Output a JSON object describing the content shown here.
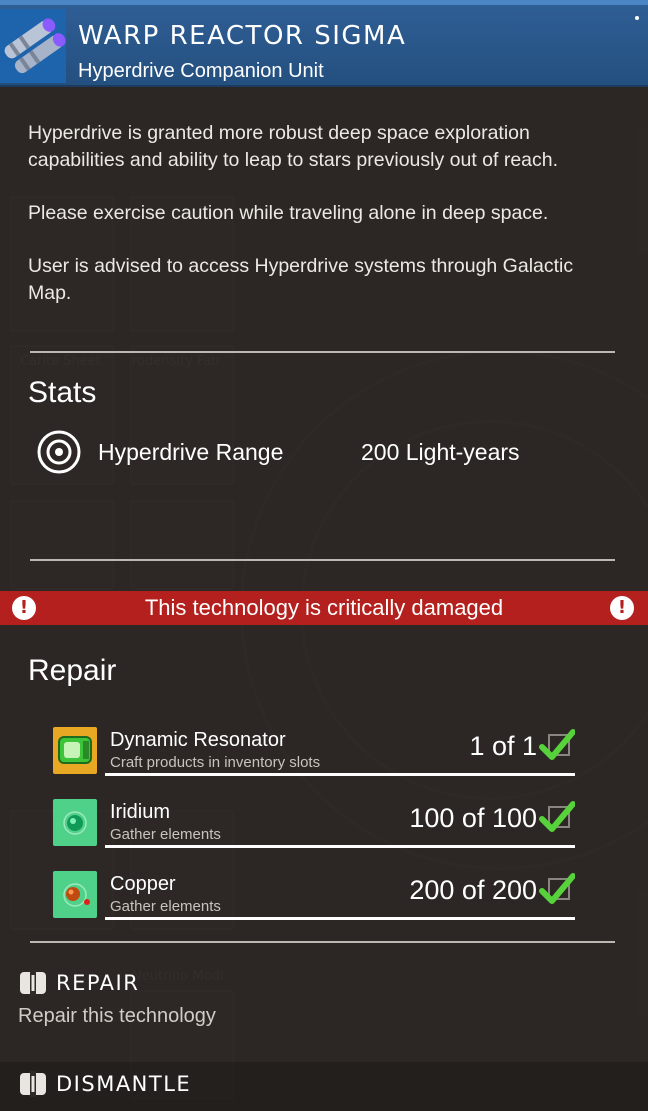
{
  "header": {
    "title": "WARP REACTOR SIGMA",
    "subtitle": "Hyperdrive Companion Unit",
    "icon": "warp-reactor-icon",
    "color": "#2f5e95"
  },
  "description": [
    "Hyperdrive is granted more robust deep space exploration capabilities and ability to leap to stars previously out of reach.",
    "Please exercise caution while traveling alone in deep space.",
    "User is advised to access Hyperdrive systems through Galactic Map."
  ],
  "stats": {
    "title": "Stats",
    "items": [
      {
        "icon": "target-icon",
        "name": "Hyperdrive Range",
        "value": "200 Light-years"
      }
    ]
  },
  "warning": {
    "text": "This technology is critically damaged",
    "color": "#b3201d"
  },
  "repair": {
    "title": "Repair",
    "requirements": [
      {
        "name": "Dynamic Resonator",
        "subtitle": "Craft products in inventory slots",
        "count": "1 of 1",
        "icon": "dynamic-resonator-icon",
        "complete": true
      },
      {
        "name": "Iridium",
        "subtitle": "Gather elements",
        "count": "100 of 100",
        "icon": "iridium-icon",
        "complete": true
      },
      {
        "name": "Copper",
        "subtitle": "Gather elements",
        "count": "200 of 200",
        "icon": "copper-icon",
        "complete": true
      }
    ]
  },
  "actions": [
    {
      "label": "REPAIR",
      "description": "Repair this technology",
      "icon": "repair-icon"
    },
    {
      "label": "DISMANTLE",
      "icon": "dismantle-icon"
    }
  ],
  "colors": {
    "check": "#57d23a",
    "element_tile": "#4fd18a",
    "product_tile": "#e8a824"
  }
}
